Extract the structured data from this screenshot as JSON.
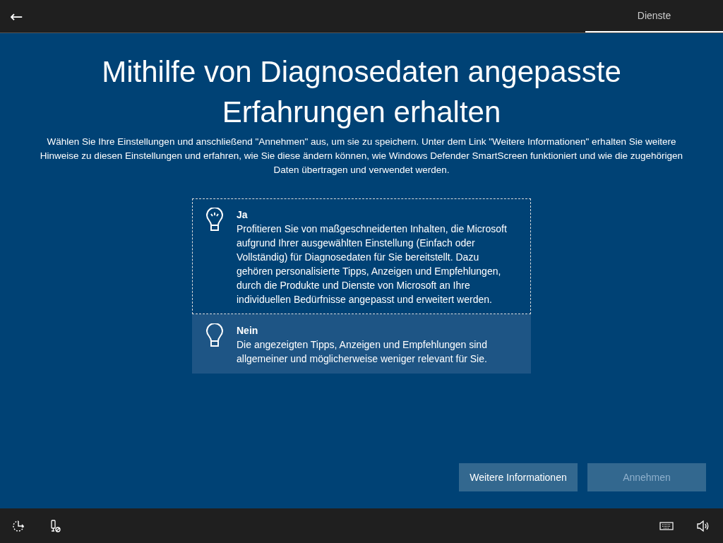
{
  "top_bar": {
    "back": "←",
    "tabs": [
      {
        "label": "Dienste",
        "selected": true
      }
    ]
  },
  "title": "Mithilfe von Diagnosedaten angepasste Erfahrungen erhalten",
  "description": "Wählen Sie Ihre Einstellungen und anschließend \"Annehmen\" aus, um sie zu speichern. Unter dem Link \"Weitere Informationen\" erhalten Sie weitere Hinweise zu diesen Einstellungen und erfahren, wie Sie diese ändern können, wie Windows Defender SmartScreen funktioniert und wie die zugehörigen Daten übertragen und verwendet werden.",
  "options": [
    {
      "kind": "lit",
      "title": "Ja",
      "text": "Profitieren Sie von maßgeschneiderten Inhalten, die Microsoft aufgrund Ihrer ausgewählten Einstellung (Einfach oder Vollständig) für Diagnosedaten für Sie bereitstellt. Dazu gehören personalisierte Tipps, Anzeigen und Empfehlungen, durch die Produkte und Dienste von Microsoft an Ihre individuellen Bedürfnisse angepasst und erweitert werden.",
      "selected": false,
      "focused": true
    },
    {
      "kind": "unlit",
      "title": "Nein",
      "text": "Die angezeigten Tipps, Anzeigen und Empfehlungen sind allgemeiner und möglicherweise weniger relevant für Sie.",
      "selected": true,
      "focused": false
    }
  ],
  "buttons": [
    {
      "label": "Weitere Informationen",
      "disabled": false
    },
    {
      "label": "Annehmen",
      "disabled": true
    }
  ]
}
